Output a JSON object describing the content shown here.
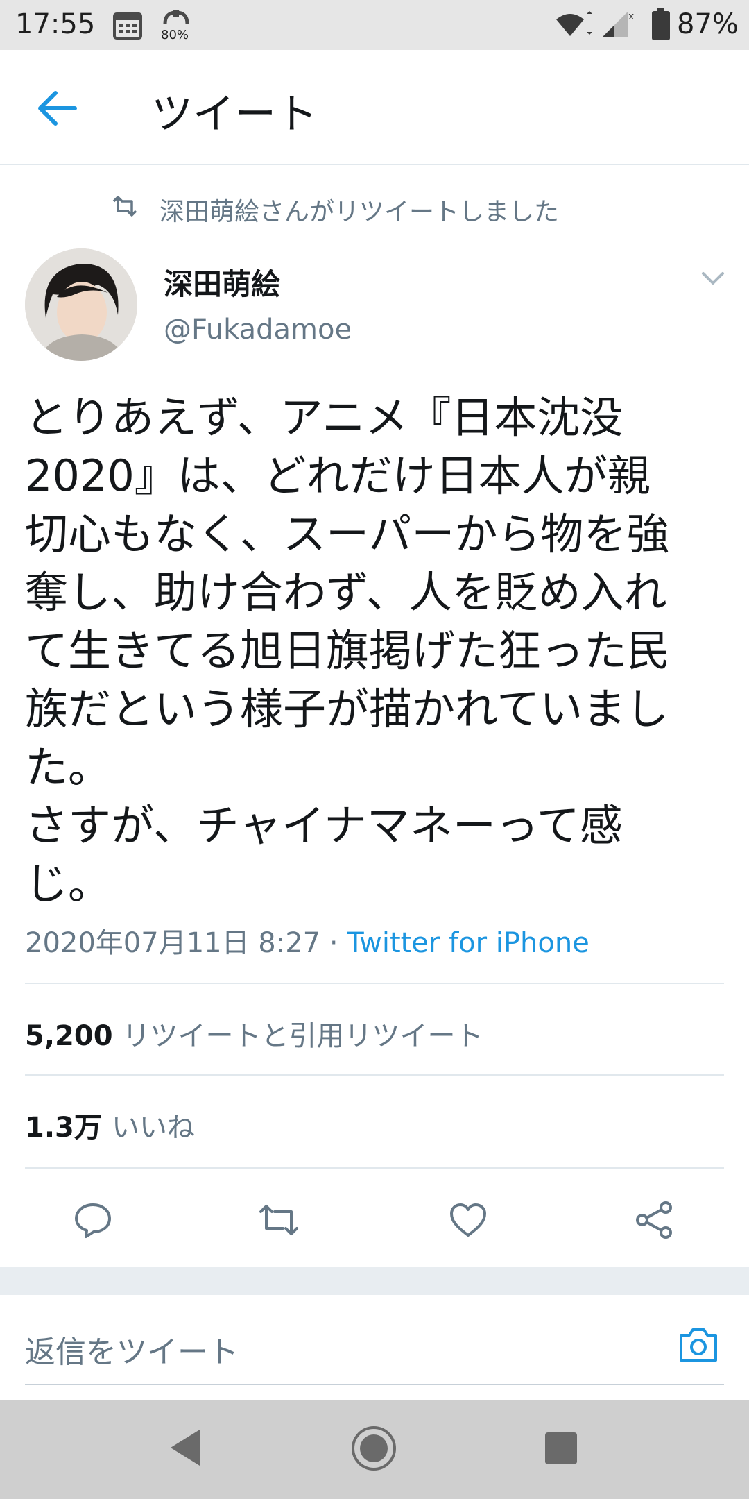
{
  "status_bar": {
    "time": "17:55",
    "data_saver_percent": "80%",
    "battery_percent": "87%"
  },
  "app_bar": {
    "title": "ツイート"
  },
  "retweet_context": {
    "text": "深田萌絵さんがリツイートしました"
  },
  "tweet": {
    "display_name": "深田萌絵",
    "handle": "@Fukadamoe",
    "body_lines": [
      "とりあえず、アニメ『日本沈没",
      "2020』は、どれだけ日本人が親",
      "切心もなく、スーパーから物を強",
      "奪し、助け合わず、人を貶め入れ",
      "て生きてる旭日旗掲げた狂った民",
      "族だという様子が描かれていまし",
      "た。",
      "さすが、チャイナマネーって感",
      "じ。"
    ],
    "timestamp": "2020年07月11日 8:27",
    "separator": "·",
    "source": "Twitter for iPhone"
  },
  "stats": {
    "retweets_count": "5,200",
    "retweets_label": "リツイートと引用リツイート",
    "likes_count": "1.3万",
    "likes_label": "いいね"
  },
  "reply": {
    "placeholder": "返信をツイート"
  },
  "colors": {
    "accent": "#1b95e0",
    "secondary_text": "#657786",
    "divider": "#e1e8ed"
  },
  "icons": [
    "calendar-icon",
    "data-saver-icon",
    "wifi-icon",
    "signal-icon",
    "battery-icon",
    "back-arrow-icon",
    "retweet-icon",
    "chevron-down-icon",
    "reply-icon",
    "retweet-action-icon",
    "like-icon",
    "share-icon",
    "camera-icon",
    "nav-back-icon",
    "nav-home-icon",
    "nav-recents-icon"
  ]
}
